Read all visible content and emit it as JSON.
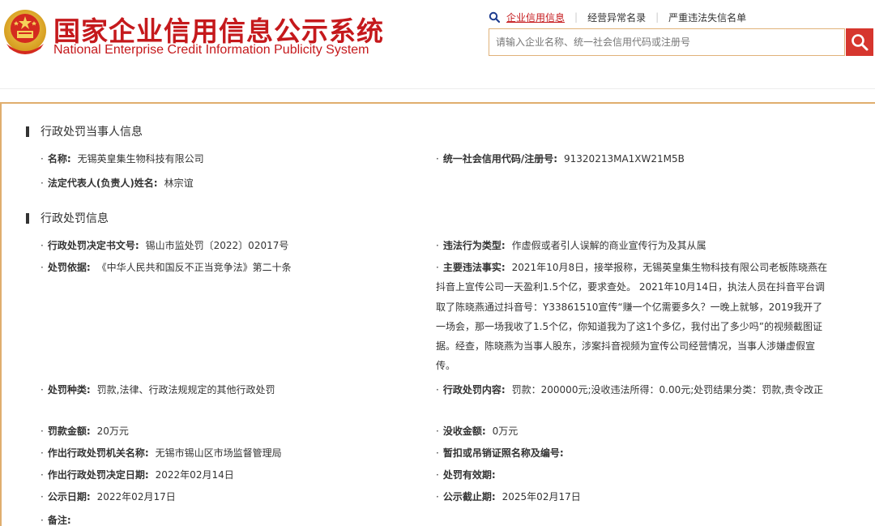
{
  "header": {
    "title_cn": "国家企业信用信息公示系统",
    "title_en": "National Enterprise Credit Information Publicity System",
    "nav": [
      {
        "label": "企业信用信息",
        "active": true
      },
      {
        "label": "经营异常名录",
        "active": false
      },
      {
        "label": "严重违法失信名单",
        "active": false
      }
    ],
    "search_placeholder": "请输入企业名称、统一社会信用代码或注册号",
    "search_icon": "search-icon",
    "brand_color": "#c5191c"
  },
  "party_section": {
    "title": "行政处罚当事人信息",
    "name_label": "名称:",
    "name_value": "无锡英皇集生物科技有限公司",
    "credit_code_label": "统一社会信用代码/注册号:",
    "credit_code_value": "91320213MA1XW21M5B",
    "legal_rep_label": "法定代表人(负责人)姓名:",
    "legal_rep_value": "林宗谊"
  },
  "penalty_section": {
    "title": "行政处罚信息",
    "decision_no_label": "行政处罚决定书文号:",
    "decision_no_value": "锡山市监处罚〔2022〕02017号",
    "violation_type_label": "违法行为类型:",
    "violation_type_value": "作虚假或者引人误解的商业宣传行为及其从属",
    "basis_label": "处罚依据:",
    "basis_value": "《中华人民共和国反不正当竞争法》第二十条",
    "facts_label": "主要违法事实:",
    "facts_value": "2021年10月8日，接举报称，无锡英皇集生物科技有限公司老板陈晓燕在抖音上宣传公司一天盈利1.5个亿，要求查处。 2021年10月14日，执法人员在抖音平台调取了陈晓燕通过抖音号：Y33861510宣传“赚一个亿需要多久？一晚上就够，2019我开了一场会，那一场我收了1.5个亿，你知道我为了这1个多亿，我付出了多少吗”的视频截图证据。经查，陈晓燕为当事人股东，涉案抖音视频为宣传公司经营情况，当事人涉嫌虚假宣传。",
    "penalty_type_label": "处罚种类:",
    "penalty_type_value": "罚款,法律、行政法规规定的其他行政处罚",
    "penalty_content_label": "行政处罚内容:",
    "penalty_content_value": "罚款：200000元;没收违法所得：0.00元;处罚结果分类：罚款,责令改正",
    "fine_label": "罚款金额:",
    "fine_value": "20万元",
    "confiscation_label": "没收金额:",
    "confiscation_value": "0万元",
    "authority_label": "作出行政处罚机关名称:",
    "authority_value": "无锡市锡山区市场监督管理局",
    "license_label": "暂扣或吊销证照名称及编号:",
    "license_value": "",
    "decision_date_label": "作出行政处罚决定日期:",
    "decision_date_value": "2022年02月14日",
    "validity_label": "处罚有效期:",
    "validity_value": "",
    "publish_date_label": "公示日期:",
    "publish_date_value": "2022年02月17日",
    "publish_end_label": "公示截止期:",
    "publish_end_value": "2025年02月17日",
    "remarks_label": "备注:",
    "remarks_value": ""
  },
  "bullet": "·"
}
